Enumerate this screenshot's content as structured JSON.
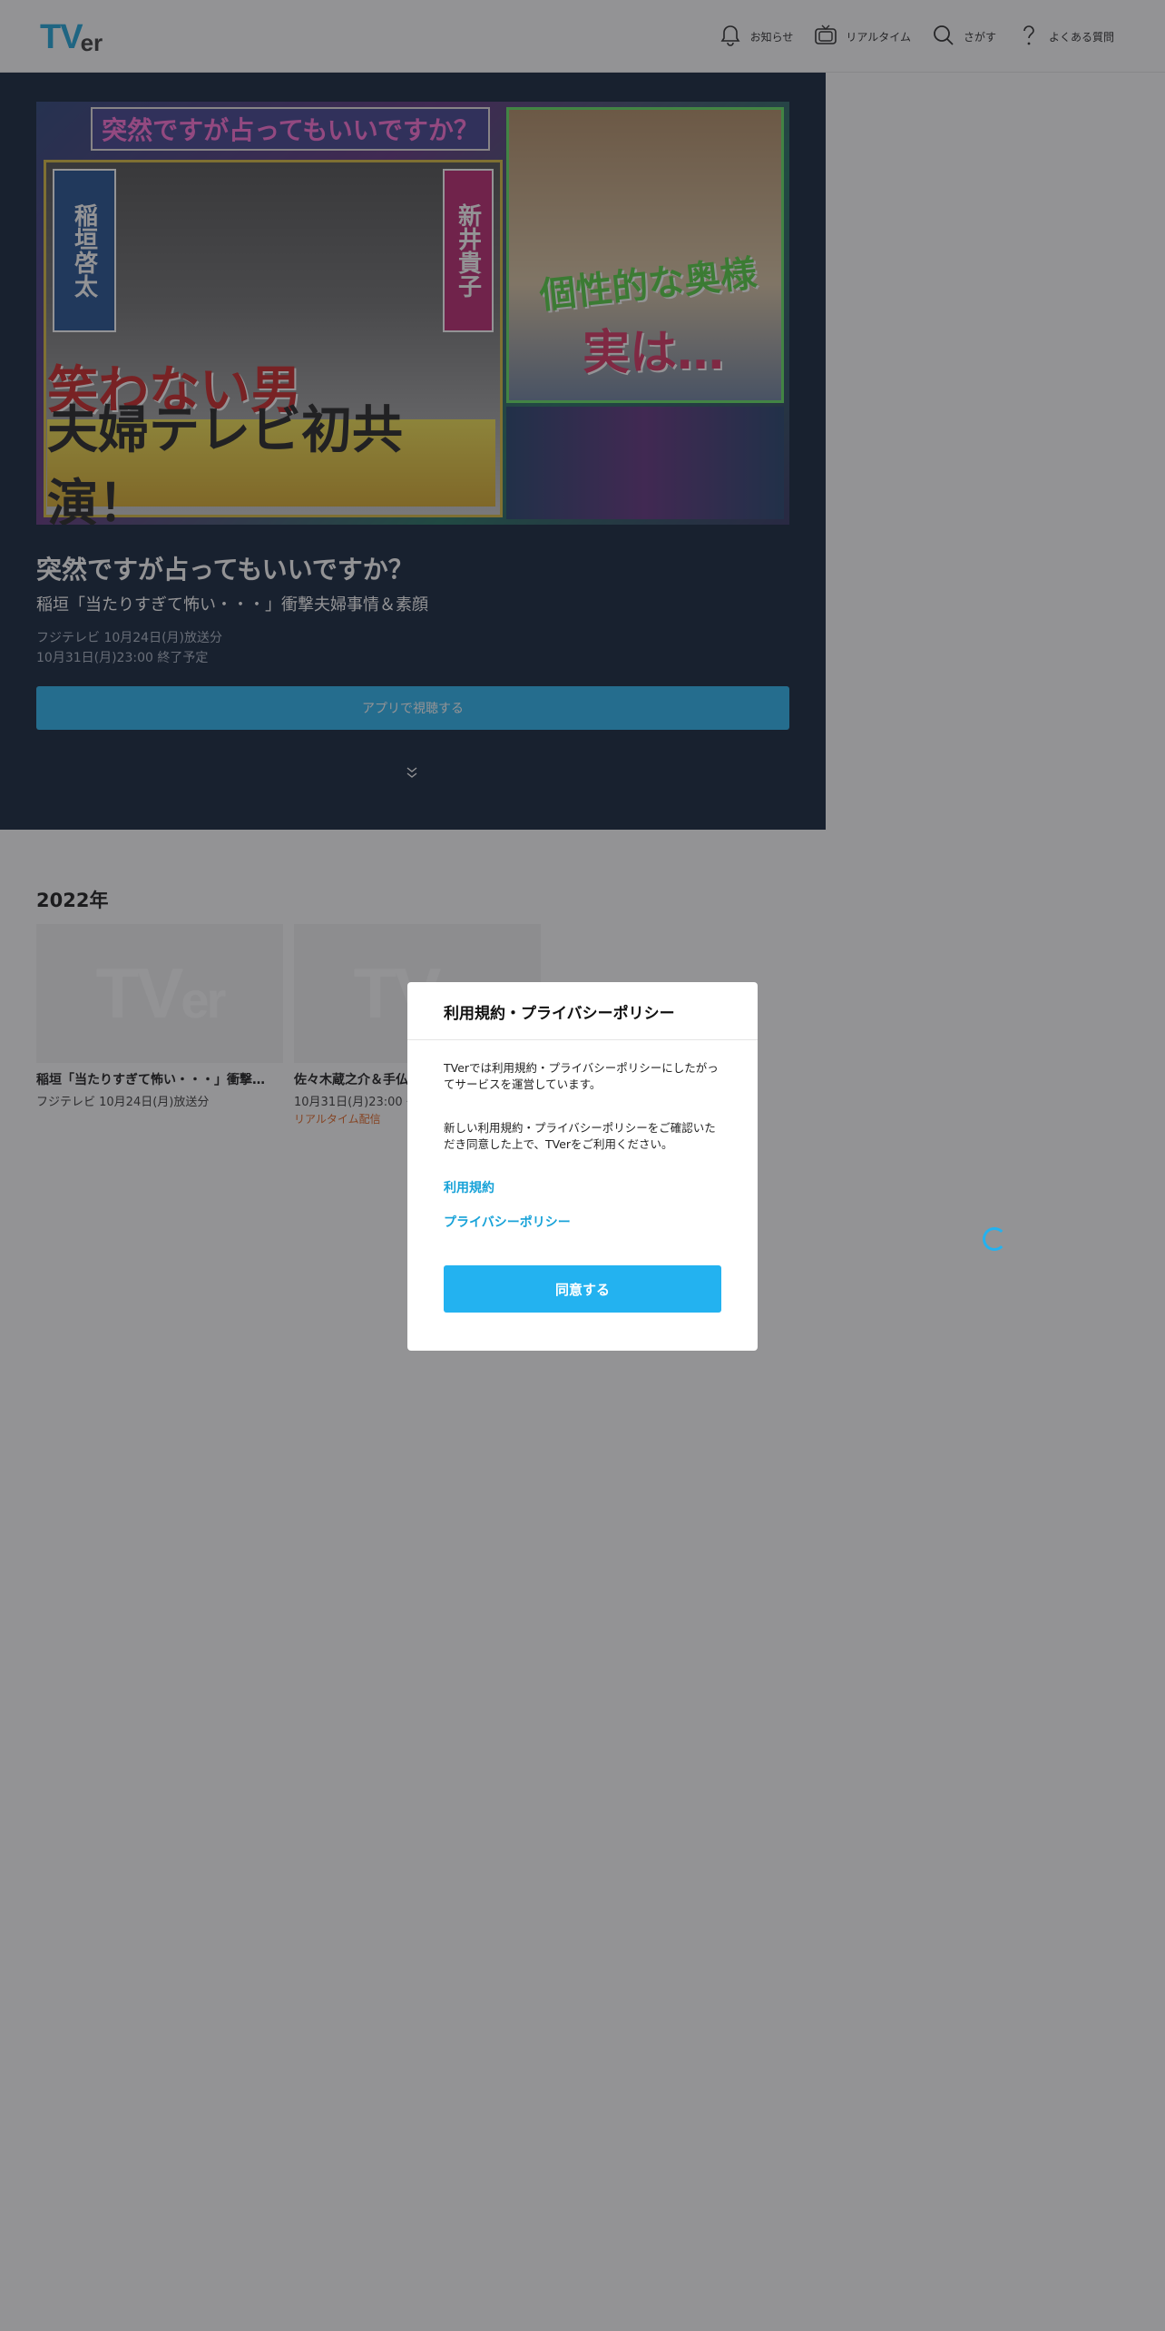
{
  "header": {
    "logo_main": "TV",
    "logo_suffix": "er",
    "nav": [
      {
        "label": "お知らせ",
        "icon": "bell-icon"
      },
      {
        "label": "リアルタイム",
        "icon": "tv-icon"
      },
      {
        "label": "さがす",
        "icon": "search-icon"
      },
      {
        "label": "よくある質問",
        "icon": "question-icon"
      }
    ]
  },
  "hero": {
    "image_text": {
      "banner": "突然ですが占ってもいいですか？",
      "tag_left": "稲垣啓太",
      "tag_right": "新井貴子",
      "caption1": "笑わない男",
      "caption2": "夫婦テレビ初共演！",
      "caption3": "個性的な奥様",
      "caption4": "実は…"
    },
    "title": "突然ですが占ってもいいですか？",
    "subtitle": "稲垣「当たりすぎて怖い・・・」衝撃夫婦事情＆素顔",
    "meta_broadcast": "フジテレビ 10月24日(月)放送分",
    "meta_end": "10月31日(月)23:00 終了予定",
    "button_label": "アプリで視聴する"
  },
  "section": {
    "title": "2022年",
    "cards": [
      {
        "placeholder_main": "TV",
        "placeholder_suffix": "er",
        "title": "稲垣「当たりすぎて怖い・・・」衝撃…",
        "meta": "フジテレビ 10月24日(月)放送分"
      },
      {
        "placeholder_main": "TV",
        "placeholder_suffix": "er",
        "title": "佐々木蔵之介＆手仏",
        "meta": "10月31日(月)23:00 〜",
        "live": "リアルタイム配信"
      }
    ]
  },
  "modal": {
    "title": "利用規約・プライバシーポリシー",
    "text1": "TVerでは利用規約・プライバシーポリシーにしたがってサービスを運営しています。",
    "text2": "新しい利用規約・プライバシーポリシーをご確認いただき同意した上で、TVerをご利用ください。",
    "link_terms": "利用規約",
    "link_privacy": "プライバシーポリシー",
    "agree_button": "同意する"
  },
  "colors": {
    "accent": "#23b2f0",
    "brand": "#17a2d8",
    "hero_bg": "#091a33",
    "live": "#e3601b"
  }
}
